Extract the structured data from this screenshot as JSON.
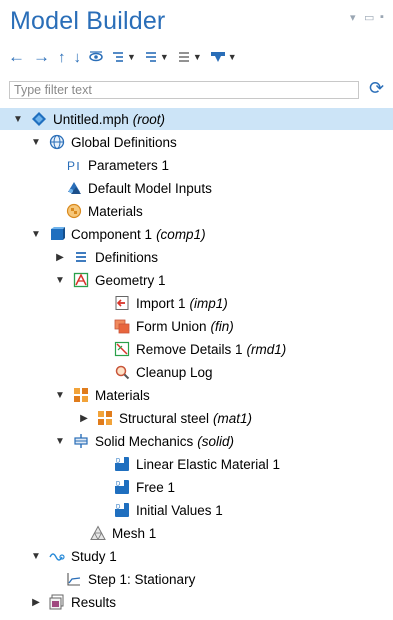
{
  "panel": {
    "title": "Model Builder",
    "filter_placeholder": "Type filter text"
  },
  "toolbar": {
    "buttons": [
      "arrow-left",
      "arrow-right",
      "arrow-up",
      "arrow-down",
      "show",
      "expand-sections",
      "collapse-sections",
      "model-tree-node-text",
      "build-menu"
    ]
  },
  "tree": [
    {
      "label": "Untitled.mph",
      "tag": "(root)",
      "expanded": true,
      "selected": true,
      "icon": "root-diamond-icon"
    },
    {
      "label": "Global Definitions",
      "tag": "",
      "expanded": true,
      "icon": "globe-icon"
    },
    {
      "label": "Parameters 1",
      "tag": "",
      "icon": "parameters-icon"
    },
    {
      "label": "Default Model Inputs",
      "tag": "",
      "icon": "model-inputs-icon"
    },
    {
      "label": "Materials",
      "tag": "",
      "icon": "materials-icon"
    },
    {
      "label": "Component 1",
      "tag": "(comp1)",
      "expanded": true,
      "icon": "component-icon"
    },
    {
      "label": "Definitions",
      "tag": "",
      "expanded": false,
      "icon": "definitions-icon"
    },
    {
      "label": "Geometry 1",
      "tag": "",
      "expanded": true,
      "icon": "geometry-icon"
    },
    {
      "label": "Import 1",
      "tag": "(imp1)",
      "icon": "import-icon"
    },
    {
      "label": "Form Union",
      "tag": "(fin)",
      "icon": "form-union-icon"
    },
    {
      "label": "Remove Details 1",
      "tag": "(rmd1)",
      "icon": "remove-details-icon"
    },
    {
      "label": "Cleanup Log",
      "tag": "",
      "icon": "cleanup-log-icon"
    },
    {
      "label": "Materials",
      "tag": "",
      "expanded": true,
      "icon": "materials-blocks-icon"
    },
    {
      "label": "Structural steel",
      "tag": "(mat1)",
      "expanded": false,
      "icon": "material-blocks-icon"
    },
    {
      "label": "Solid Mechanics",
      "tag": "(solid)",
      "expanded": true,
      "icon": "solid-mechanics-icon"
    },
    {
      "label": "Linear Elastic Material 1",
      "tag": "",
      "icon": "linear-elastic-icon"
    },
    {
      "label": "Free 1",
      "tag": "",
      "icon": "free-icon"
    },
    {
      "label": "Initial Values 1",
      "tag": "",
      "icon": "initial-values-icon"
    },
    {
      "label": "Mesh 1",
      "tag": "",
      "icon": "mesh-icon"
    },
    {
      "label": "Study 1",
      "tag": "",
      "expanded": true,
      "icon": "study-icon"
    },
    {
      "label": "Step 1: Stationary",
      "tag": "",
      "icon": "stationary-step-icon"
    },
    {
      "label": "Results",
      "tag": "",
      "expanded": false,
      "icon": "results-icon"
    }
  ]
}
